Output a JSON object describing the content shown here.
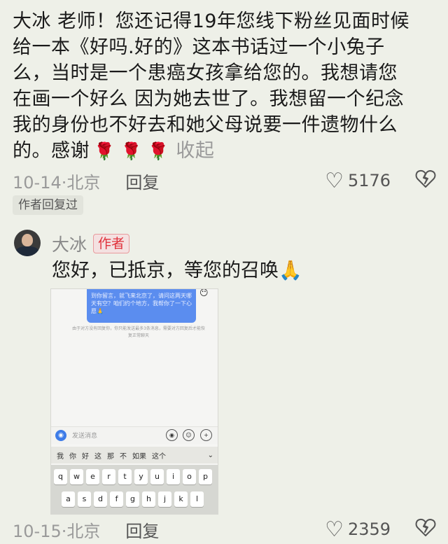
{
  "comment": {
    "lines": [
      "大冰 老师！您还记得19年您线下粉丝见面时候",
      "给一本《好吗.好的》这本书话过一个小兔子",
      "么，当时是一个患癌女孩拿给您的。我想请您",
      "在画一个好么 因为她去世了。我想留一个纪念",
      "我的身份也不好去和她父母说要一件遗物什么"
    ],
    "last_line": "的。感谢",
    "roses": "🌹 🌹 🌹",
    "collapse_label": "收起",
    "date_location": "10-14·北京",
    "reply_label": "回复",
    "like_count": "5176",
    "author_replied": "作者回复过"
  },
  "reply": {
    "author": "大冰",
    "author_badge": "作者",
    "text": "您好，已抵京，等您的召唤",
    "emoji": "🙏",
    "date_location": "10-15·北京",
    "reply_label": "回复",
    "like_count": "2359"
  },
  "screenshot": {
    "bubble_text": "到你留言，就飞来北京了，请问这两天哪天有空？咱们约个地方，我帮你了一下心愿🙏",
    "system_note": "由于对方没有回复你，你只能发送最多3条消息，需要对方回复后才能恢复正常聊天",
    "input_placeholder": "发送消息",
    "suggestions": [
      "我",
      "你",
      "好",
      "这",
      "那",
      "不",
      "如果",
      "这个"
    ],
    "suggest_more": "⌄",
    "row1": [
      "q",
      "w",
      "e",
      "r",
      "t",
      "y",
      "u",
      "i",
      "o",
      "p"
    ],
    "row2": [
      "a",
      "s",
      "d",
      "f",
      "g",
      "h",
      "j",
      "k",
      "l"
    ]
  },
  "icons": {
    "heart": "heart-outline-icon",
    "broken_heart": "broken-heart-icon",
    "accent": "#e0323c",
    "muted": "#9a9a9a"
  }
}
